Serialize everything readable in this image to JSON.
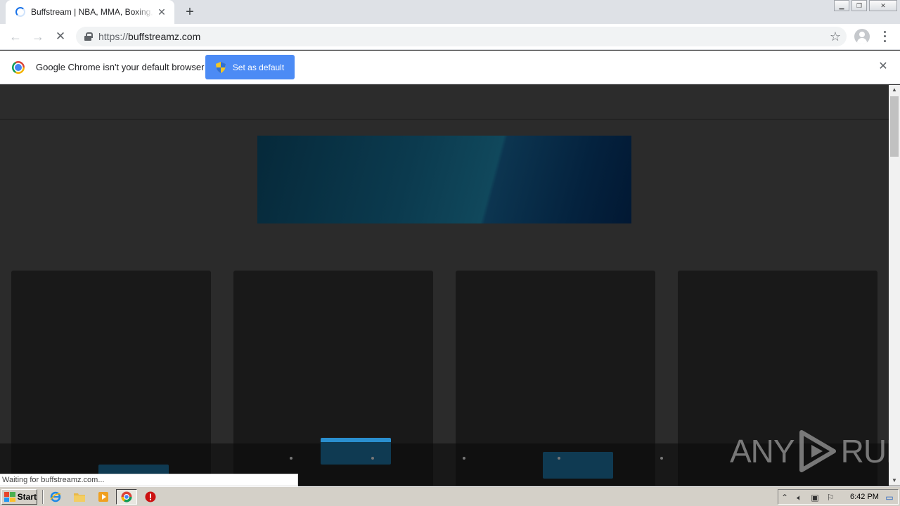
{
  "browser": {
    "tab": {
      "title": "Buffstream | NBA, MMA, Boxing, NFL",
      "close": "✕"
    },
    "new_tab": "+",
    "window_controls": {
      "minimize": "▁",
      "restore": "❐",
      "close": "✕"
    },
    "url": {
      "scheme": "https://",
      "host": "buffstreamz.com"
    },
    "nav": {
      "back": "←",
      "forward": "→",
      "stop": "✕"
    },
    "star": "☆"
  },
  "infobar": {
    "message": "Google Chrome isn't your default browser",
    "button_label": "Set as default",
    "close": "✕"
  },
  "status_bubble": "Waiting for buffstreamz.com...",
  "watermark": {
    "text_left": "ANY",
    "text_right": "RUN"
  },
  "taskbar": {
    "start_label": "Start",
    "clock": "6:42 PM"
  }
}
